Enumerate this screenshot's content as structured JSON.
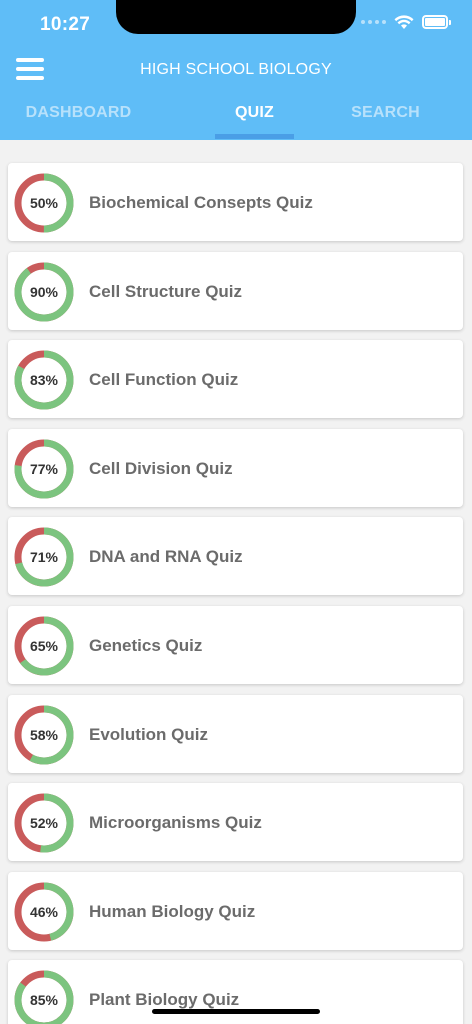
{
  "status_bar": {
    "time": "10:27"
  },
  "header": {
    "title": "HIGH SCHOOL BIOLOGY"
  },
  "tabs": [
    {
      "label": "DASHBOARD",
      "active": false
    },
    {
      "label": "QUIZ",
      "active": true
    },
    {
      "label": "SEARCH",
      "active": false
    }
  ],
  "colors": {
    "header": "#5fbdf7",
    "tab_indicator": "#4a9ee6",
    "correct": "#7cc47f",
    "incorrect": "#c95b5b"
  },
  "quizzes": [
    {
      "name": "Biochemical Consepts Quiz",
      "percent_label": "50%",
      "percent": 50
    },
    {
      "name": "Cell Structure Quiz",
      "percent_label": "90%",
      "percent": 90
    },
    {
      "name": "Cell Function Quiz",
      "percent_label": "83%",
      "percent": 83
    },
    {
      "name": "Cell Division Quiz",
      "percent_label": "77%",
      "percent": 77
    },
    {
      "name": "DNA and RNA Quiz",
      "percent_label": "71%",
      "percent": 71
    },
    {
      "name": "Genetics Quiz",
      "percent_label": "65%",
      "percent": 65
    },
    {
      "name": "Evolution Quiz",
      "percent_label": "58%",
      "percent": 58
    },
    {
      "name": "Microorganisms Quiz",
      "percent_label": "52%",
      "percent": 52
    },
    {
      "name": "Human Biology Quiz",
      "percent_label": "46%",
      "percent": 46
    },
    {
      "name": "Plant Biology Quiz",
      "percent_label": "85%",
      "percent": 85
    }
  ]
}
